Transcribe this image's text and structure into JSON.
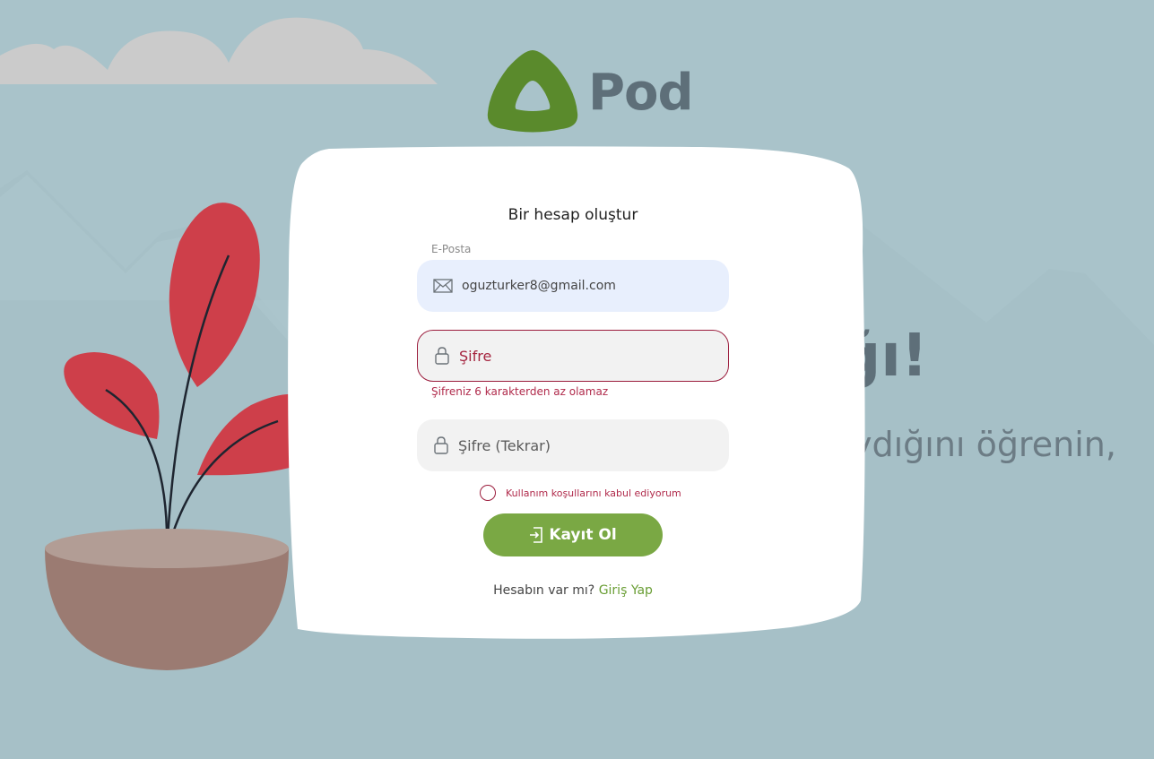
{
  "brand": {
    "name": "Pod",
    "color": "#5a8a2c"
  },
  "hero": {
    "title_partial": "ğı!",
    "subtitle_partial": "ydığını öğrenin,"
  },
  "form": {
    "title": "Bir hesap oluştur",
    "email": {
      "label": "E-Posta",
      "value": "oguzturker8@gmail.com",
      "icon": "mail-icon"
    },
    "password": {
      "placeholder": "Şifre",
      "error": "Şifreniz 6 karakterden az olamaz",
      "icon": "lock-icon"
    },
    "password_repeat": {
      "placeholder": "Şifre (Tekrar)",
      "icon": "lock-icon"
    },
    "terms_label": "Kullanım koşullarını kabul ediyorum",
    "submit_label": "Kayıt Ol",
    "submit_icon": "sign-in-icon",
    "have_account_text": "Hesabın var mı?",
    "login_link": "Giriş Yap"
  },
  "colors": {
    "accent": "#7aa844",
    "error": "#9b1c3c",
    "background": "#a9c3ca"
  }
}
